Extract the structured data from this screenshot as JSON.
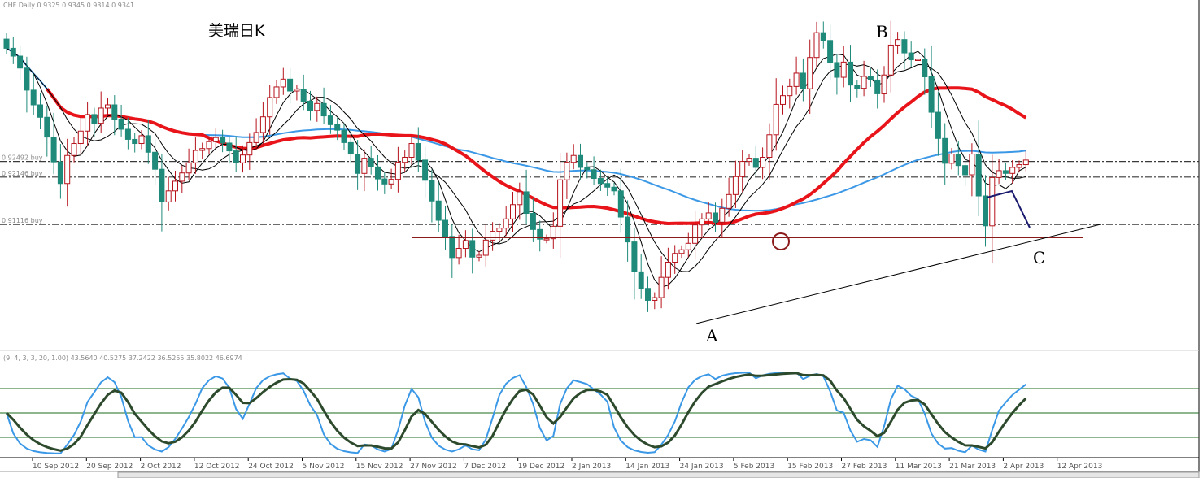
{
  "header": {
    "symbol_info": "CHF Daily  0.9325 0.9345 0.9314 0.9341"
  },
  "annotation_title": "美瑞日K",
  "wave_labels": {
    "a": "A",
    "b": "B",
    "c": "C"
  },
  "price_levels": [
    {
      "label": "0.92492 buy",
      "price": 0.9249
    },
    {
      "label": "0.92146 buy",
      "price": 0.9215
    },
    {
      "label": "0.91116 buy",
      "price": 0.9112
    }
  ],
  "indicator_header": "(9, 4, 3, 3, 20, 1.00) 43.5640 40.5275 37.2422 36.5255 35.8022 46.6974",
  "colors": {
    "bull": "#b5121b",
    "bear": "#1f8a7a",
    "ma_slow": "#e8141a",
    "ma_mid": "#3b98e6",
    "ma_fast": "#000000",
    "support": "#8b1a1a",
    "osc_fast": "#3b98e6",
    "osc_slow": "#2d4a2d",
    "osc_level": "#1e6e1e"
  },
  "chart_data": {
    "type": "candlestick",
    "timeframe": "Daily",
    "ylim": [
      0.884,
      0.96
    ],
    "x_tick_labels": [
      "10 Sep 2012",
      "20 Sep 2012",
      "2 Oct 2012",
      "12 Oct 2012",
      "24 Oct 2012",
      "5 Nov 2012",
      "15 Nov 2012",
      "27 Nov 2012",
      "7 Dec 2012",
      "19 Dec 2012",
      "2 Jan 2013",
      "14 Jan 2013",
      "24 Jan 2013",
      "5 Feb 2013",
      "15 Feb 2013",
      "27 Feb 2013",
      "11 Mar 2013",
      "21 Mar 2013",
      "2 Apr 2013",
      "12 Apr 2013"
    ],
    "close": [
      0.9495,
      0.9478,
      0.9452,
      0.9404,
      0.9372,
      0.9345,
      0.9302,
      0.9248,
      0.9201,
      0.9262,
      0.9288,
      0.9315,
      0.9351,
      0.9332,
      0.9365,
      0.9372,
      0.9341,
      0.9319,
      0.9297,
      0.9288,
      0.9305,
      0.9269,
      0.9232,
      0.9161,
      0.9185,
      0.9206,
      0.9224,
      0.9246,
      0.9273,
      0.9277,
      0.9292,
      0.9301,
      0.9289,
      0.9272,
      0.9246,
      0.9263,
      0.929,
      0.9312,
      0.9346,
      0.9388,
      0.9411,
      0.9428,
      0.9402,
      0.9406,
      0.938,
      0.936,
      0.9375,
      0.9348,
      0.9329,
      0.9317,
      0.929,
      0.9265,
      0.9223,
      0.9256,
      0.9237,
      0.9211,
      0.92,
      0.921,
      0.9247,
      0.9258,
      0.9288,
      0.9252,
      0.9208,
      0.9163,
      0.9121,
      0.9086,
      0.904,
      0.906,
      0.9077,
      0.9041,
      0.9045,
      0.9078,
      0.9097,
      0.9104,
      0.9124,
      0.9155,
      0.9183,
      0.9136,
      0.9101,
      0.908,
      0.9081,
      0.9108,
      0.9209,
      0.9247,
      0.9262,
      0.9236,
      0.9231,
      0.9212,
      0.9201,
      0.9193,
      0.9185,
      0.9128,
      0.9074,
      0.9009,
      0.8973,
      0.8947,
      0.8953,
      0.8997,
      0.903,
      0.9049,
      0.9057,
      0.9071,
      0.9111,
      0.9124,
      0.9137,
      0.9117,
      0.9147,
      0.9177,
      0.9216,
      0.9249,
      0.9256,
      0.9236,
      0.9258,
      0.9307,
      0.9373,
      0.9392,
      0.9412,
      0.9441,
      0.9407,
      0.9475,
      0.9529,
      0.9512,
      0.9464,
      0.9432,
      0.9465,
      0.9415,
      0.9408,
      0.9434,
      0.9426,
      0.9396,
      0.9437,
      0.9502,
      0.9514,
      0.9485,
      0.947,
      0.9471,
      0.9433,
      0.9356,
      0.9299,
      0.9245,
      0.9265,
      0.924,
      0.922,
      0.9265,
      0.9174,
      0.9109,
      0.9214,
      0.9229,
      0.9223,
      0.9236,
      0.9242,
      0.9252
    ]
  }
}
